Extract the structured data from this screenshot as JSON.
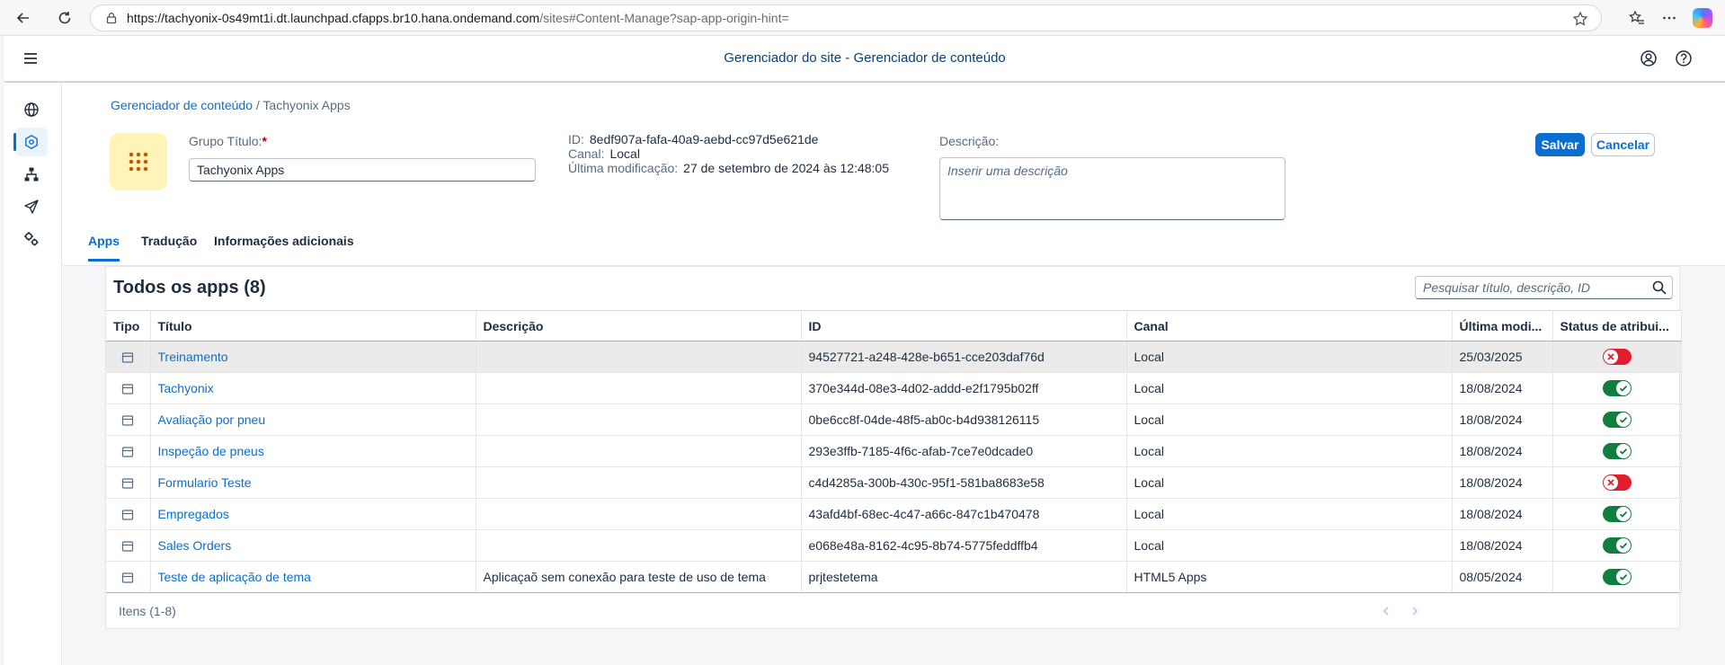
{
  "browser": {
    "url_host": "https://tachyonix-0s49mt1i.dt.launchpad.cfapps.br10.hana.ondemand.com",
    "url_path": "/sites#Content-Manage?sap-app-origin-hint="
  },
  "shell": {
    "title": "Gerenciador do site - Gerenciador de conteúdo"
  },
  "rail": {
    "items": [
      "globe-icon",
      "content-icon",
      "hierarchy-icon",
      "send-icon",
      "settings-icon"
    ],
    "active_index": 1
  },
  "breadcrumb": {
    "link": "Gerenciador de conteúdo",
    "separator": "/",
    "current": "Tachyonix Apps"
  },
  "header": {
    "group_title_label": "Grupo Título:",
    "required_mark": "*",
    "group_title_value": "Tachyonix Apps",
    "id_label": "ID:",
    "id_value": "8edf907a-fafa-40a9-aebd-cc97d5e621de",
    "channel_label": "Canal:",
    "channel_value": "Local",
    "modified_label": "Última modificação:",
    "modified_value": "27 de setembro de 2024 às 12:48:05",
    "description_label": "Descrição:",
    "description_placeholder": "Inserir uma descrição",
    "save_label": "Salvar",
    "cancel_label": "Cancelar",
    "tile_color": "#fff3b8",
    "tile_icon_color": "#c35500"
  },
  "tabs": [
    {
      "label": "Apps",
      "active": true
    },
    {
      "label": "Tradução",
      "active": false
    },
    {
      "label": "Informações adicionais",
      "active": false
    }
  ],
  "table": {
    "title": "Todos os apps (8)",
    "search_placeholder": "Pesquisar título, descrição, ID",
    "columns": [
      "Tipo",
      "Título",
      "Descrição",
      "ID",
      "Canal",
      "Última modi...",
      "Status de atribui..."
    ],
    "rows": [
      {
        "title": "Treinamento",
        "description": "",
        "id": "94527721-a248-428e-b651-cce203daf76d",
        "channel": "Local",
        "modified": "25/03/2025",
        "status": "error",
        "selected": true
      },
      {
        "title": "Tachyonix",
        "description": "",
        "id": "370e344d-08e3-4d02-addd-e2f1795b02ff",
        "channel": "Local",
        "modified": "18/08/2024",
        "status": "ok",
        "selected": false
      },
      {
        "title": "Avaliação por pneu",
        "description": "",
        "id": "0be6cc8f-04de-48f5-ab0c-b4d938126115",
        "channel": "Local",
        "modified": "18/08/2024",
        "status": "ok",
        "selected": false
      },
      {
        "title": "Inspeção de pneus",
        "description": "",
        "id": "293e3ffb-7185-4f6c-afab-7ce7e0dcade0",
        "channel": "Local",
        "modified": "18/08/2024",
        "status": "ok",
        "selected": false
      },
      {
        "title": "Formulario Teste",
        "description": "",
        "id": "c4d4285a-300b-430c-95f1-581ba8683e58",
        "channel": "Local",
        "modified": "18/08/2024",
        "status": "error",
        "selected": false
      },
      {
        "title": "Empregados",
        "description": "",
        "id": "43afd4bf-68ec-4c47-a66c-847c1b470478",
        "channel": "Local",
        "modified": "18/08/2024",
        "status": "ok",
        "selected": false
      },
      {
        "title": "Sales Orders",
        "description": "",
        "id": "e068e48a-8162-4c95-8b74-5775feddffb4",
        "channel": "Local",
        "modified": "18/08/2024",
        "status": "ok",
        "selected": false
      },
      {
        "title": "Teste de aplicação de tema",
        "description": "Aplicaçaõ sem conexão para teste de uso de tema",
        "id": "prjtestetema",
        "channel": "HTML5 Apps",
        "modified": "08/05/2024",
        "status": "ok",
        "selected": false
      }
    ],
    "items_count": "Itens (1-8)",
    "status_colors": {
      "ok": "#107e3e",
      "error": "#e11e2c"
    }
  }
}
